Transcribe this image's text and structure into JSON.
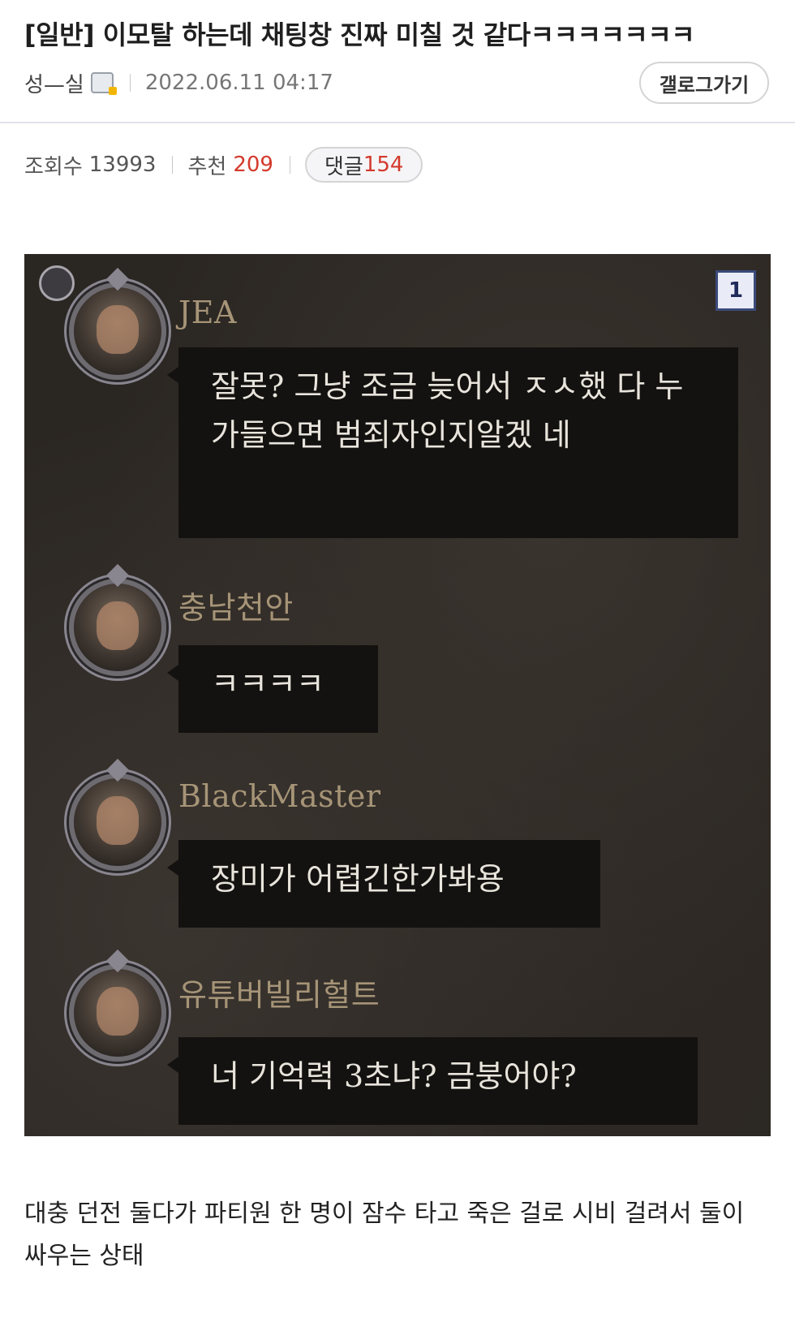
{
  "post": {
    "title": "[일반] 이모탈 하는데 채팅창 진짜 미칠 것 같다ㅋㅋㅋㅋㅋㅋㅋ",
    "author": "성—실",
    "date": "2022.06.11 04:17",
    "gallery_button": "갤로그가기"
  },
  "stats": {
    "views_label": "조회수",
    "views": "13993",
    "recommend_label": "추천",
    "recommend": "209",
    "comments_label": "댓글",
    "comments": "154"
  },
  "screenshot": {
    "page_number": "1",
    "messages": [
      {
        "user": "JEA",
        "text": "잘못? 그냥 조금 늦어서 ㅈㅅ했 다 누가들으면 범죄자인지알겠 네"
      },
      {
        "user": "충남천안",
        "text": "ㅋㅋㅋㅋ"
      },
      {
        "user": "BlackMaster",
        "text": "장미가 어렵긴한가봐용"
      },
      {
        "user": "유튜버빌리헐트",
        "text": "너 기억력 3초냐? 금붕어야?"
      }
    ]
  },
  "body": {
    "text": "대충 던전 둘다가 파티원 한 명이 잠수 타고 죽은 걸로 시비 걸려서 둘이 싸우는 상태"
  }
}
